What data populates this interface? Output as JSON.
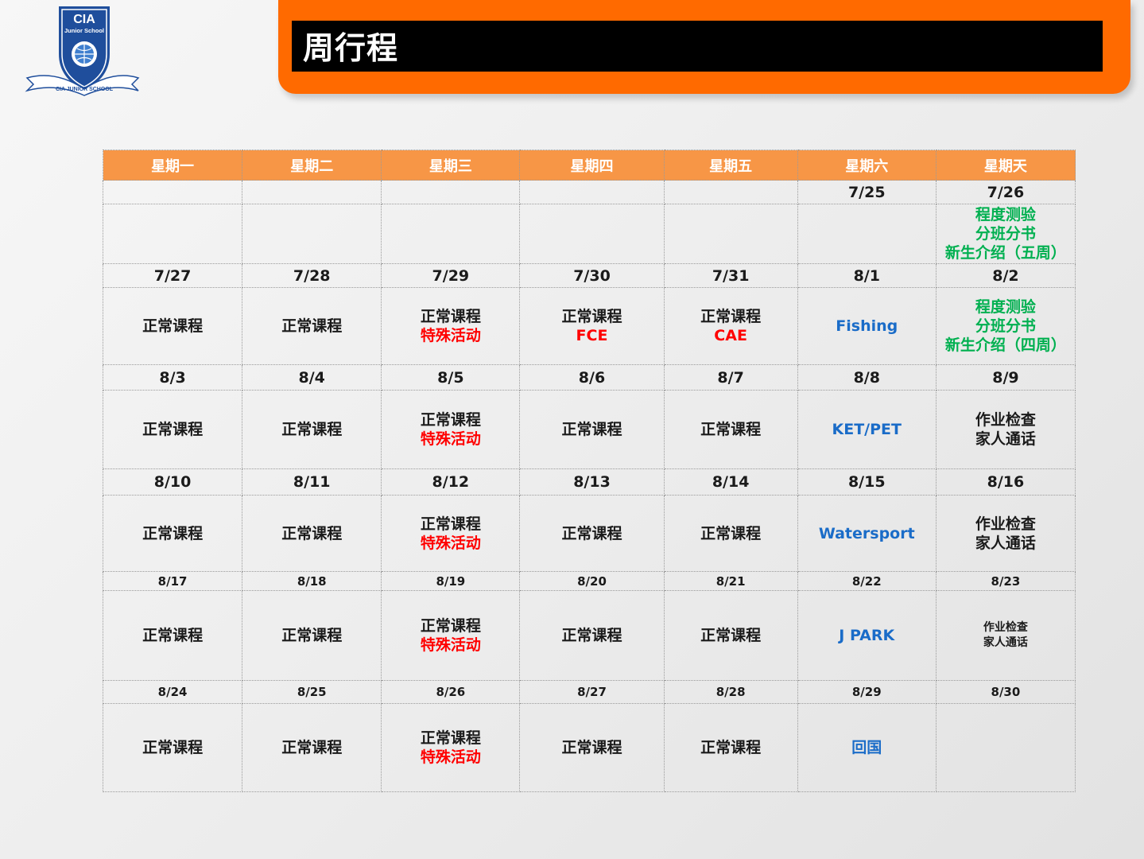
{
  "logo": {
    "brand": "CIA",
    "sub": "Junior School",
    "ribbon": "CIA JUNIOR SCHOOL"
  },
  "header": {
    "title": "周行程"
  },
  "colors": {
    "orange": "#ff6a00",
    "header_row": "#f79646",
    "red": "#ff0000",
    "green": "#00b050",
    "blue": "#1a6cc8"
  },
  "table": {
    "days": [
      "星期一",
      "星期二",
      "星期三",
      "星期四",
      "星期五",
      "星期六",
      "星期天"
    ],
    "weeks": [
      {
        "dates": [
          "",
          "",
          "",
          "",
          "",
          "7/25",
          "7/26"
        ],
        "acts": [
          [],
          [],
          [],
          [],
          [],
          [],
          [
            {
              "t": "程度测验",
              "c": "green"
            },
            {
              "t": "分班分书",
              "c": "green"
            },
            {
              "t": "新生介绍（五周）",
              "c": "green"
            }
          ]
        ]
      },
      {
        "dates": [
          "7/27",
          "7/28",
          "7/29",
          "7/30",
          "7/31",
          "8/1",
          "8/2"
        ],
        "acts": [
          [
            {
              "t": "正常课程",
              "c": "dark"
            }
          ],
          [
            {
              "t": "正常课程",
              "c": "dark"
            }
          ],
          [
            {
              "t": "正常课程",
              "c": "dark"
            },
            {
              "t": "特殊活动",
              "c": "red"
            }
          ],
          [
            {
              "t": "正常课程",
              "c": "dark"
            },
            {
              "t": "FCE",
              "c": "red"
            }
          ],
          [
            {
              "t": "正常课程",
              "c": "dark"
            },
            {
              "t": "CAE",
              "c": "red"
            }
          ],
          [
            {
              "t": "Fishing",
              "c": "blue"
            }
          ],
          [
            {
              "t": "程度测验",
              "c": "green"
            },
            {
              "t": "分班分书",
              "c": "green"
            },
            {
              "t": "新生介绍（四周）",
              "c": "green"
            }
          ]
        ]
      },
      {
        "dates": [
          "8/3",
          "8/4",
          "8/5",
          "8/6",
          "8/7",
          "8/8",
          "8/9"
        ],
        "acts": [
          [
            {
              "t": "正常课程",
              "c": "dark"
            }
          ],
          [
            {
              "t": "正常课程",
              "c": "dark"
            }
          ],
          [
            {
              "t": "正常课程",
              "c": "dark"
            },
            {
              "t": "特殊活动",
              "c": "red"
            }
          ],
          [
            {
              "t": "正常课程",
              "c": "dark"
            }
          ],
          [
            {
              "t": "正常课程",
              "c": "dark"
            }
          ],
          [
            {
              "t": "KET/PET",
              "c": "blue"
            }
          ],
          [
            {
              "t": "作业检查",
              "c": "dark"
            },
            {
              "t": "家人通话",
              "c": "dark"
            }
          ]
        ]
      },
      {
        "dates": [
          "8/10",
          "8/11",
          "8/12",
          "8/13",
          "8/14",
          "8/15",
          "8/16"
        ],
        "acts": [
          [
            {
              "t": "正常课程",
              "c": "dark"
            }
          ],
          [
            {
              "t": "正常课程",
              "c": "dark"
            }
          ],
          [
            {
              "t": "正常课程",
              "c": "dark"
            },
            {
              "t": "特殊活动",
              "c": "red"
            }
          ],
          [
            {
              "t": "正常课程",
              "c": "dark"
            }
          ],
          [
            {
              "t": "正常课程",
              "c": "dark"
            }
          ],
          [
            {
              "t": "Watersport",
              "c": "blue"
            }
          ],
          [
            {
              "t": "作业检查",
              "c": "dark"
            },
            {
              "t": "家人通话",
              "c": "dark"
            }
          ]
        ]
      },
      {
        "dates": [
          "8/17",
          "8/18",
          "8/19",
          "8/20",
          "8/21",
          "8/22",
          "8/23"
        ],
        "acts": [
          [
            {
              "t": "正常课程",
              "c": "dark"
            }
          ],
          [
            {
              "t": "正常课程",
              "c": "dark"
            }
          ],
          [
            {
              "t": "正常课程",
              "c": "dark"
            },
            {
              "t": "特殊活动",
              "c": "red"
            }
          ],
          [
            {
              "t": "正常课程",
              "c": "dark"
            }
          ],
          [
            {
              "t": "正常课程",
              "c": "dark"
            }
          ],
          [
            {
              "t": "J PARK",
              "c": "blue"
            }
          ],
          [
            {
              "t": "作业检查",
              "c": "dark"
            },
            {
              "t": "家人通话",
              "c": "dark"
            }
          ]
        ]
      },
      {
        "dates": [
          "8/24",
          "8/25",
          "8/26",
          "8/27",
          "8/28",
          "8/29",
          "8/30"
        ],
        "acts": [
          [
            {
              "t": "正常课程",
              "c": "dark"
            }
          ],
          [
            {
              "t": "正常课程",
              "c": "dark"
            }
          ],
          [
            {
              "t": "正常课程",
              "c": "dark"
            },
            {
              "t": "特殊活动",
              "c": "red"
            }
          ],
          [
            {
              "t": "正常课程",
              "c": "dark"
            }
          ],
          [
            {
              "t": "正常课程",
              "c": "dark"
            }
          ],
          [
            {
              "t": "回国",
              "c": "blue"
            }
          ],
          []
        ]
      }
    ]
  }
}
